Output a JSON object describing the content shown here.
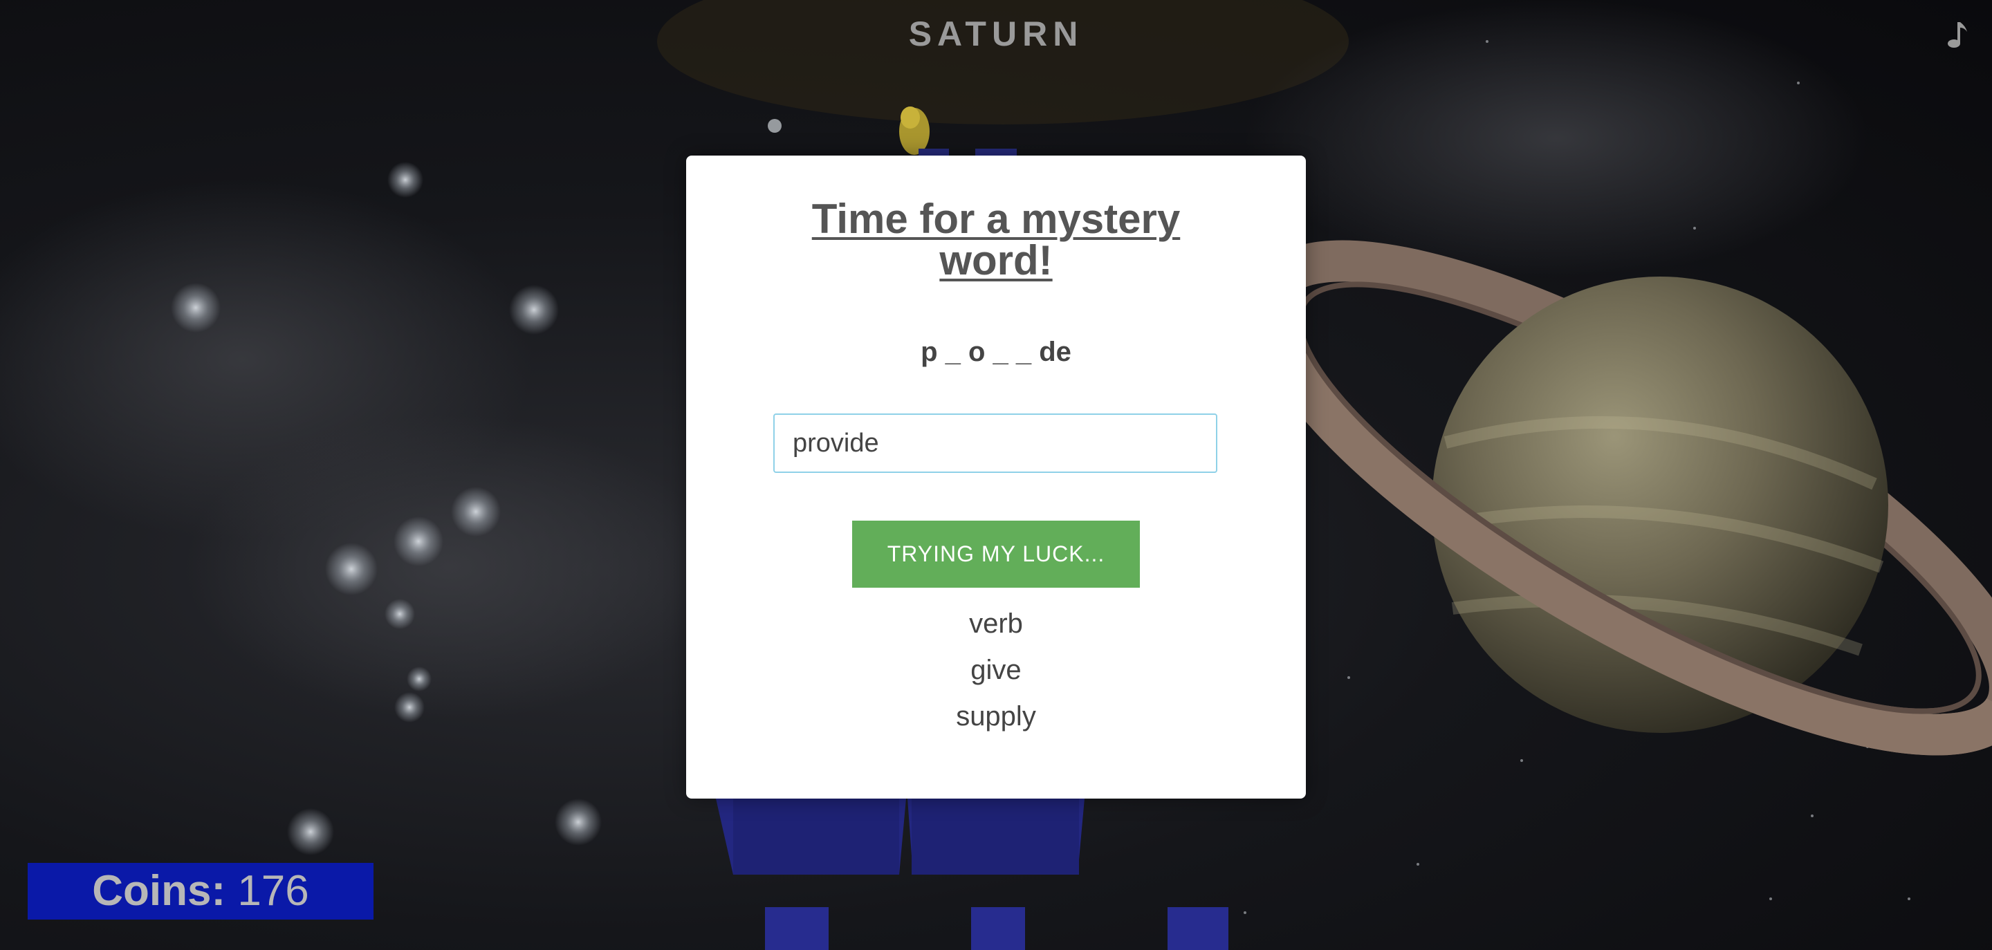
{
  "game": {
    "title": "SATURN"
  },
  "coins": {
    "label": "Coins:",
    "value": "176"
  },
  "modal": {
    "title": "Time for a mystery word!",
    "hint": "p _ o _ _ de",
    "input_value": "provide",
    "button_label": "TRYING MY LUCK...",
    "clues": [
      "verb",
      "give",
      "supply"
    ]
  },
  "icons": {
    "music": "music-note-icon"
  },
  "colors": {
    "button": "#62ae59",
    "coins_bg": "#0a19a8",
    "blocks": "#2a2f92"
  }
}
